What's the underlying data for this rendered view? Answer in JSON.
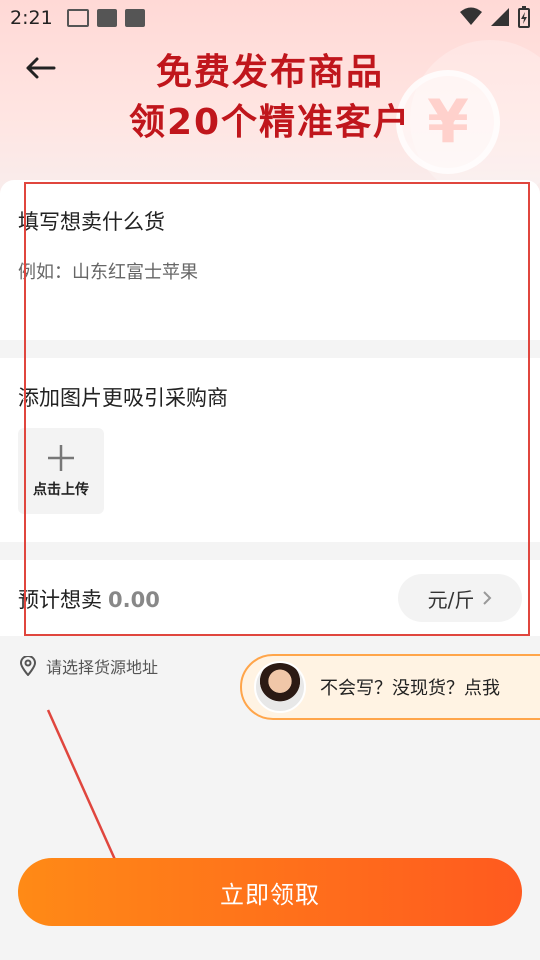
{
  "status_bar": {
    "time": "2:21"
  },
  "header": {
    "headline_line1": "免费发布商品",
    "headline_line2": "领20个精准客户",
    "coin_symbol": "¥"
  },
  "form": {
    "item_section": {
      "label": "填写想卖什么货",
      "placeholder": "例如：山东红富士苹果"
    },
    "image_section": {
      "label": "添加图片更吸引采购商",
      "upload_label": "点击上传"
    },
    "price_section": {
      "label": "预计想卖",
      "value": "0.00",
      "unit": "元/斤"
    }
  },
  "address": {
    "label": "请选择货源地址"
  },
  "helper": {
    "text": "不会写？没现货？点我"
  },
  "cta": {
    "label": "立即领取"
  },
  "colors": {
    "headline": "#c0161c",
    "cta_start": "#ff8a16",
    "cta_end": "#ff5a1f",
    "highlight": "#e0463e"
  }
}
